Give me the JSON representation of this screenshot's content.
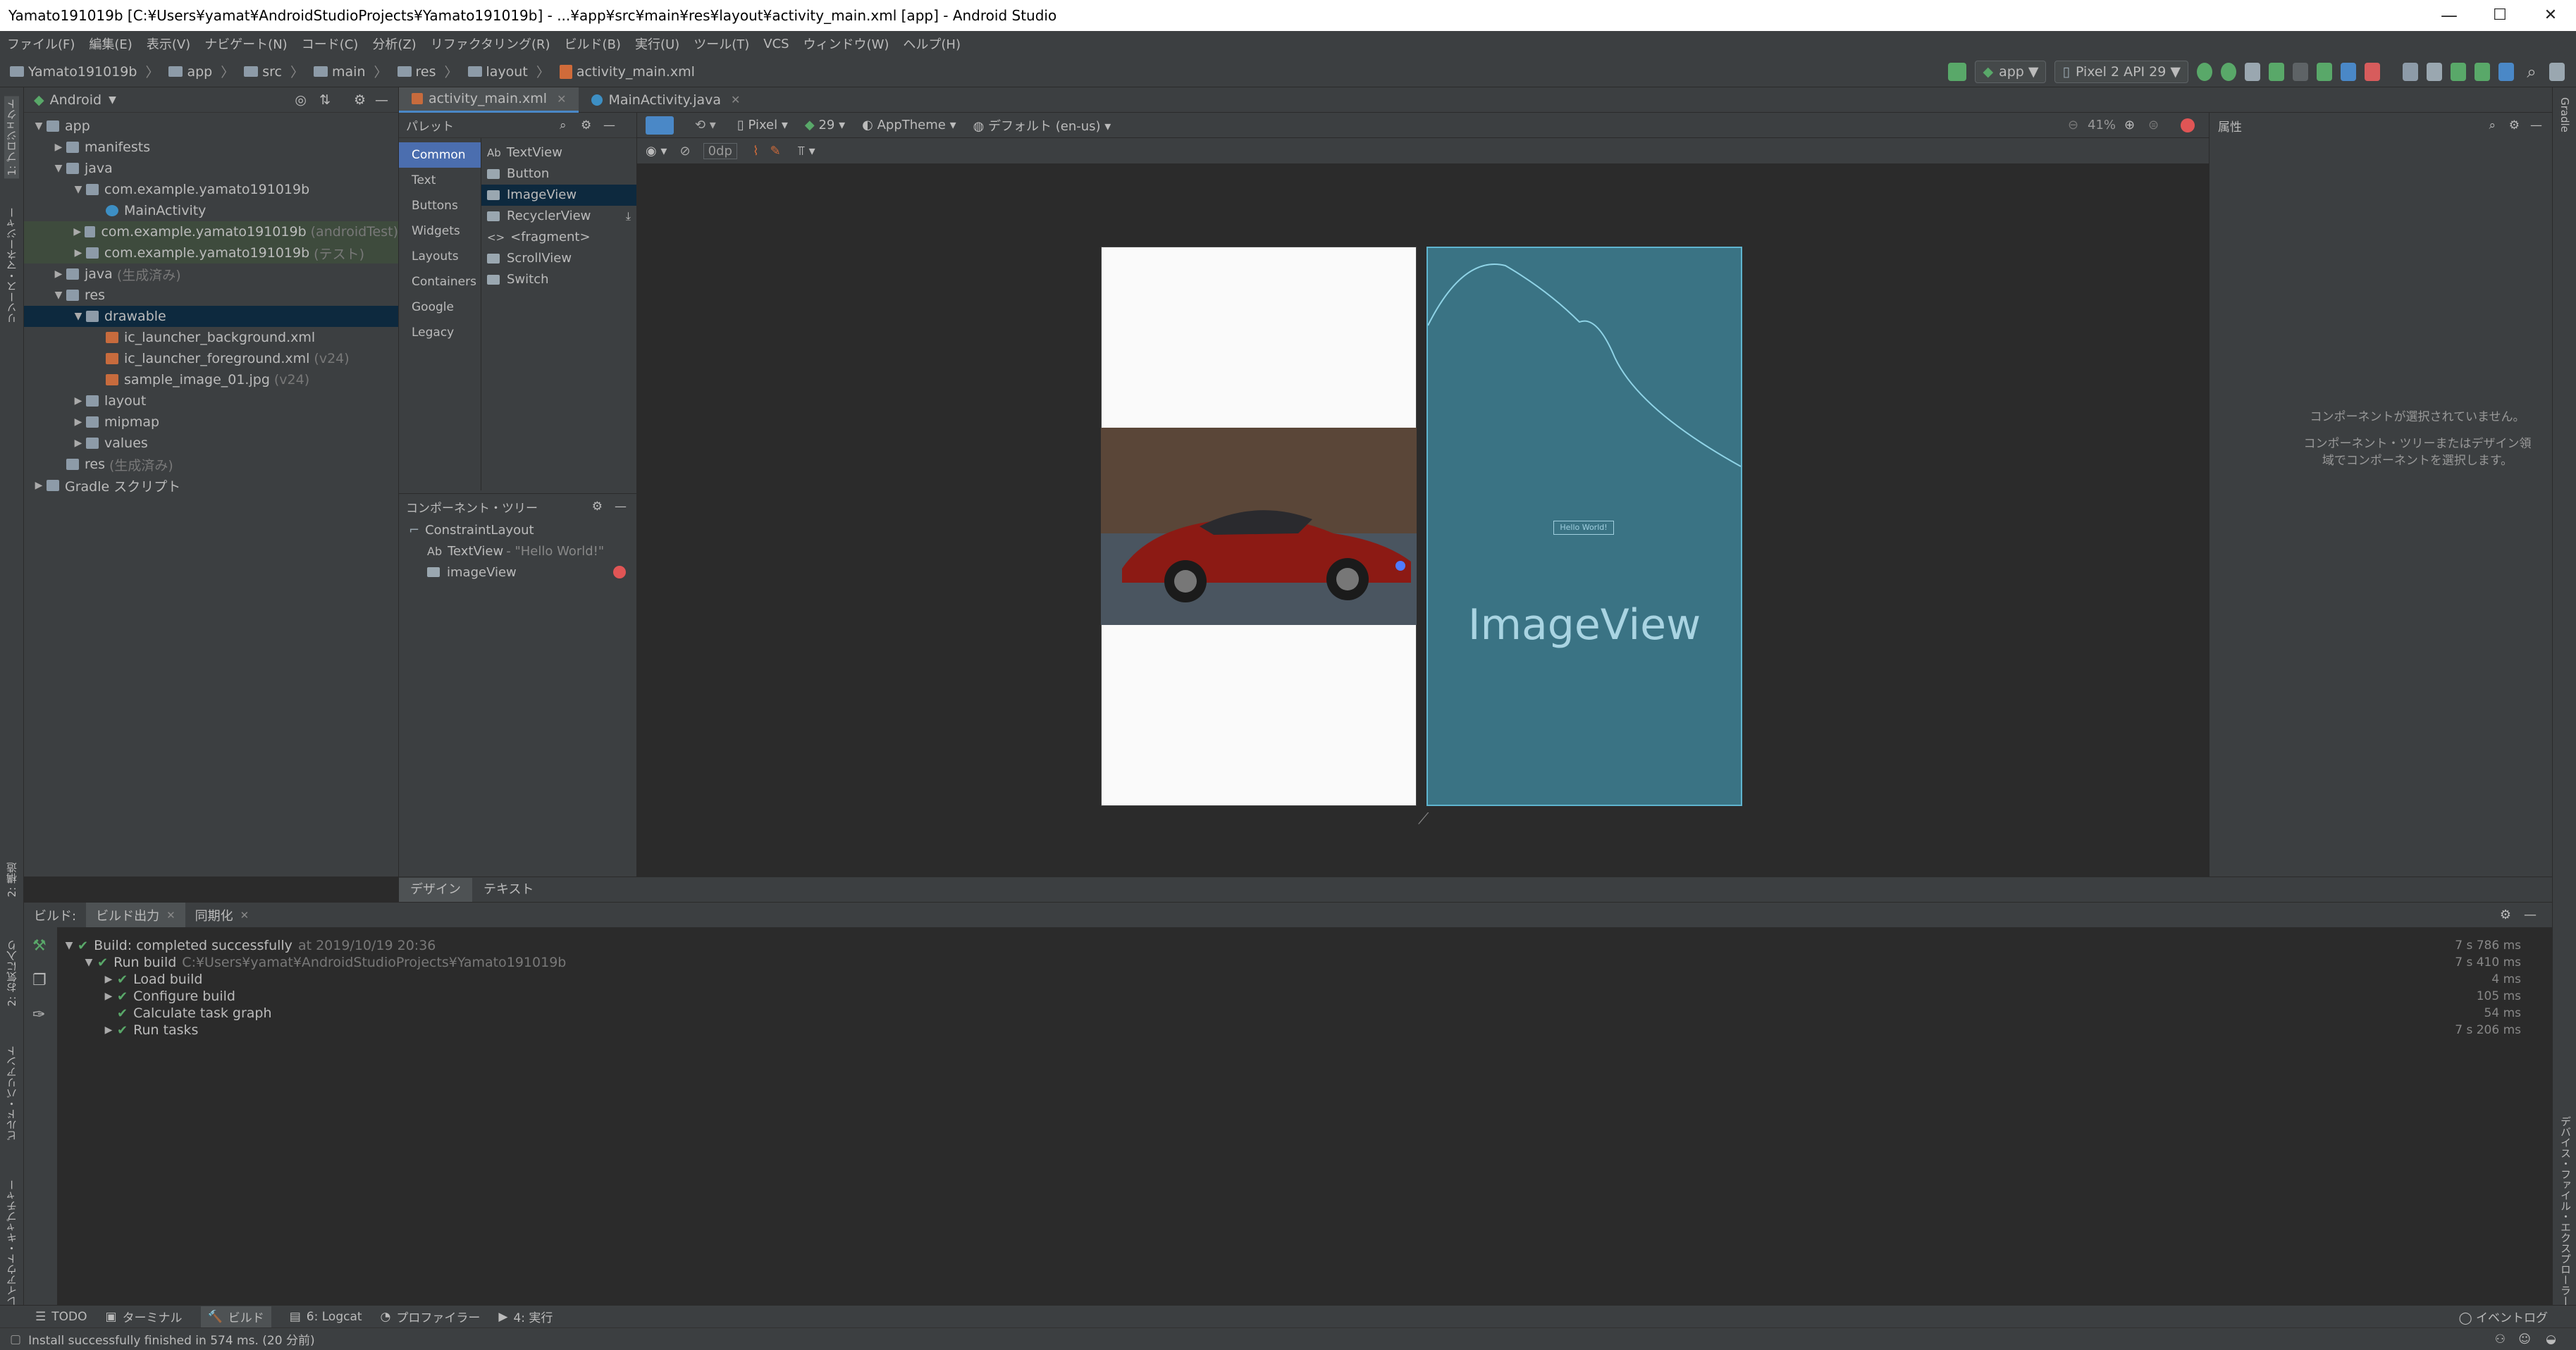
{
  "window": {
    "title": "Yamato191019b [C:¥Users¥yamat¥AndroidStudioProjects¥Yamato191019b] - ...¥app¥src¥main¥res¥layout¥activity_main.xml [app] - Android Studio",
    "minimize": "—",
    "maximize": "☐",
    "close": "✕"
  },
  "menubar": [
    "ファイル(F)",
    "編集(E)",
    "表示(V)",
    "ナビゲート(N)",
    "コード(C)",
    "分析(Z)",
    "リファクタリング(R)",
    "ビルド(B)",
    "実行(U)",
    "ツール(T)",
    "VCS",
    "ウィンドウ(W)",
    "ヘルプ(H)"
  ],
  "breadcrumb": [
    "Yamato191019b",
    "app",
    "src",
    "main",
    "res",
    "layout",
    "activity_main.xml"
  ],
  "toolbar": {
    "run_config": "app",
    "device": "Pixel 2 API 29"
  },
  "project_panel": {
    "view_mode": "Android",
    "items": [
      {
        "label": "app",
        "depth": 0,
        "arrow": "▼",
        "state": ""
      },
      {
        "label": "manifests",
        "depth": 1,
        "arrow": "▶",
        "state": ""
      },
      {
        "label": "java",
        "depth": 1,
        "arrow": "▼",
        "state": ""
      },
      {
        "label": "com.example.yamato191019b",
        "depth": 2,
        "arrow": "▼",
        "state": ""
      },
      {
        "label": "MainActivity",
        "depth": 3,
        "arrow": "",
        "state": ""
      },
      {
        "label": "com.example.yamato191019b",
        "depth": 2,
        "arrow": "▶",
        "state": "grn",
        "dim": "(androidTest)"
      },
      {
        "label": "com.example.yamato191019b",
        "depth": 2,
        "arrow": "▶",
        "state": "grn",
        "dim": "(テスト)"
      },
      {
        "label": "java",
        "depth": 1,
        "arrow": "▶",
        "state": "",
        "dim": "(生成済み)"
      },
      {
        "label": "res",
        "depth": 1,
        "arrow": "▼",
        "state": ""
      },
      {
        "label": "drawable",
        "depth": 2,
        "arrow": "▼",
        "state": "sel"
      },
      {
        "label": "ic_launcher_background.xml",
        "depth": 3,
        "arrow": "",
        "state": ""
      },
      {
        "label": "ic_launcher_foreground.xml",
        "depth": 3,
        "arrow": "",
        "state": "",
        "dim": "(v24)"
      },
      {
        "label": "sample_image_01.jpg",
        "depth": 3,
        "arrow": "",
        "state": "",
        "dim": "(v24)"
      },
      {
        "label": "layout",
        "depth": 2,
        "arrow": "▶",
        "state": ""
      },
      {
        "label": "mipmap",
        "depth": 2,
        "arrow": "▶",
        "state": ""
      },
      {
        "label": "values",
        "depth": 2,
        "arrow": "▶",
        "state": ""
      },
      {
        "label": "res",
        "depth": 1,
        "arrow": "",
        "state": "",
        "dim": "(生成済み)"
      },
      {
        "label": "Gradle スクリプト",
        "depth": 0,
        "arrow": "▶",
        "state": ""
      }
    ]
  },
  "left_stripe": {
    "project": "1: プロジェクト",
    "resource_manager": "リソース・マネージャー",
    "structure": "2: 構造",
    "favorites": "2: お気に入り",
    "build_variants": "ビルド・バリアント",
    "layout_capture": "レイアウト・キャプチャー"
  },
  "right_stripe": {
    "gradle": "Gradle",
    "device_explorer": "デバイス・ファイル・エクスプローラー"
  },
  "editor_tabs": [
    {
      "label": "activity_main.xml",
      "active": true
    },
    {
      "label": "MainActivity.java",
      "active": false
    }
  ],
  "palette": {
    "title": "パレット",
    "categories": [
      "Common",
      "Text",
      "Buttons",
      "Widgets",
      "Layouts",
      "Containers",
      "Google",
      "Legacy"
    ],
    "items": [
      {
        "label": "TextView",
        "prefix": "Ab",
        "sel": false
      },
      {
        "label": "Button",
        "sel": false
      },
      {
        "label": "ImageView",
        "sel": true
      },
      {
        "label": "RecyclerView",
        "sel": false
      },
      {
        "label": "<fragment>",
        "prefix": "<>",
        "sel": false
      },
      {
        "label": "ScrollView",
        "sel": false
      },
      {
        "label": "Switch",
        "sel": false
      }
    ]
  },
  "component_tree": {
    "title": "コンポーネント・ツリー",
    "root": "ConstraintLayout",
    "textview_prefix": "Ab",
    "textview": "TextView",
    "textview_value": "- \"Hello World!\"",
    "imageview": "imageView"
  },
  "design_toolbar": {
    "device": "Pixel",
    "api": "29",
    "theme": "AppTheme",
    "locale": "デフォルト (en-us)",
    "zoom": "41%",
    "margin": "0dp"
  },
  "blueprint": {
    "label": "ImageView",
    "hello": "Hello World!"
  },
  "attributes": {
    "title": "属性",
    "empty_line1": "コンポーネントが選択されていません。",
    "empty_line2": "コンポーネント・ツリーまたはデザイン領域でコンポーネントを選択します。"
  },
  "design_tabs": [
    "デザイン",
    "テキスト"
  ],
  "build_panel": {
    "tabs": [
      "ビルド:",
      "ビルド出力",
      "同期化"
    ],
    "rows": [
      {
        "label": "Build: completed successfully",
        "dim": "at 2019/10/19 20:36",
        "depth": 0,
        "arrow": "▼",
        "time": "7 s 786 ms"
      },
      {
        "label": "Run build",
        "dim": "C:¥Users¥yamat¥AndroidStudioProjects¥Yamato191019b",
        "depth": 1,
        "arrow": "▼",
        "time": "7 s 410 ms"
      },
      {
        "label": "Load build",
        "dim": "",
        "depth": 2,
        "arrow": "▶",
        "time": "4 ms"
      },
      {
        "label": "Configure build",
        "dim": "",
        "depth": 2,
        "arrow": "▶",
        "time": "105 ms"
      },
      {
        "label": "Calculate task graph",
        "dim": "",
        "depth": 2,
        "arrow": "",
        "time": "54 ms"
      },
      {
        "label": "Run tasks",
        "dim": "",
        "depth": 2,
        "arrow": "▶",
        "time": "7 s 206 ms"
      }
    ]
  },
  "bottom_tools": [
    {
      "label": "TODO",
      "glyph": "☰",
      "active": false
    },
    {
      "label": "ターミナル",
      "glyph": "▣",
      "active": false
    },
    {
      "label": "ビルド",
      "glyph": "🔨",
      "active": true
    },
    {
      "label": "6: Logcat",
      "glyph": "▤",
      "active": false
    },
    {
      "label": "プロファイラー",
      "glyph": "◔",
      "active": false
    },
    {
      "label": "4: 実行",
      "glyph": "▶",
      "active": false
    }
  ],
  "event_log": "イベントログ",
  "status": "Install successfully finished in 574 ms. (20 分前)",
  "colors": {
    "accent": "#4b6eaf",
    "selection": "#0d293e",
    "blueprint": "#3a7384",
    "success": "#59a869",
    "error": "#e05555"
  }
}
